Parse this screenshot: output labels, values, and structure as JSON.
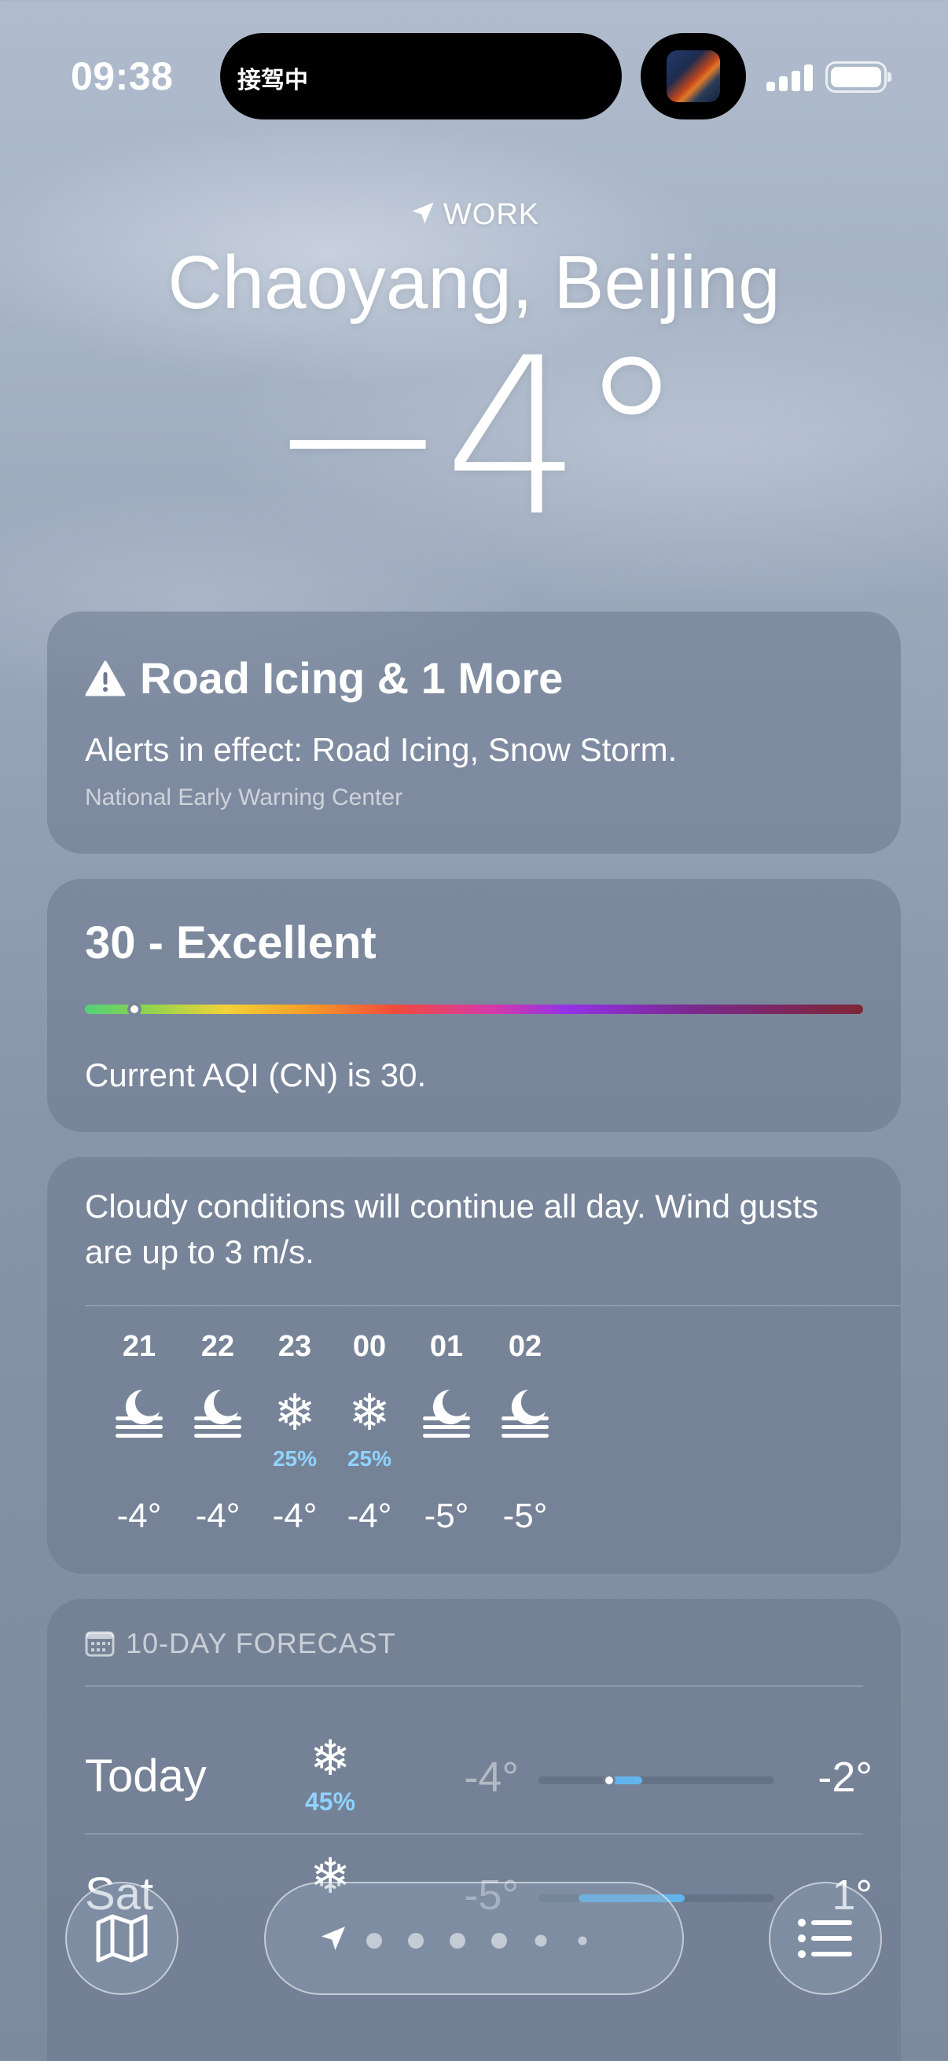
{
  "status_bar": {
    "time": "09:38",
    "island_text": "接驾中"
  },
  "header": {
    "location_label": "WORK",
    "city": "Chaoyang, Beijing",
    "current_temp": "−4°"
  },
  "alert": {
    "title": "Road Icing & 1 More",
    "description": "Alerts in effect: Road Icing, Snow Storm.",
    "source": "National Early Warning Center"
  },
  "aqi": {
    "title": "30 - Excellent",
    "description": "Current AQI (CN) is 30.",
    "indicator_position": 0.064
  },
  "hourly": {
    "summary": "Cloudy conditions will continue all day. Wind gusts are up to 3 m/s.",
    "items": [
      {
        "hour": "21",
        "icon": "moon-fog-icon",
        "precip": "",
        "temp": "-4°"
      },
      {
        "hour": "22",
        "icon": "moon-fog-icon",
        "precip": "",
        "temp": "-4°"
      },
      {
        "hour": "23",
        "icon": "snowflake-icon",
        "precip": "25%",
        "temp": "-4°"
      },
      {
        "hour": "00",
        "icon": "snowflake-icon",
        "precip": "25%",
        "temp": "-4°"
      },
      {
        "hour": "01",
        "icon": "moon-fog-icon",
        "precip": "",
        "temp": "-5°"
      },
      {
        "hour": "02",
        "icon": "moon-fog-icon",
        "precip": "",
        "temp": "-5°"
      }
    ]
  },
  "forecast": {
    "header": "10-DAY FORECAST",
    "days": [
      {
        "day": "Today",
        "icon": "snowflake-icon",
        "precip": "45%",
        "low": "-4°",
        "high": "-2°",
        "range_start": 0.3,
        "range_end": 0.44,
        "current": 0.3
      },
      {
        "day": "Sat",
        "icon": "snowflake-icon",
        "precip": "",
        "low": "-5°",
        "high": "1°",
        "range_start": 0.17,
        "range_end": 0.62,
        "current": null
      }
    ]
  },
  "toolbar": {
    "map_icon": "map-icon",
    "location_icon": "location-arrow-icon",
    "list_icon": "list-icon",
    "page_count": 7,
    "active_page": 0
  },
  "colors": {
    "precip_blue": "#8fd3ff",
    "range_fill": "#5fb4f0"
  }
}
